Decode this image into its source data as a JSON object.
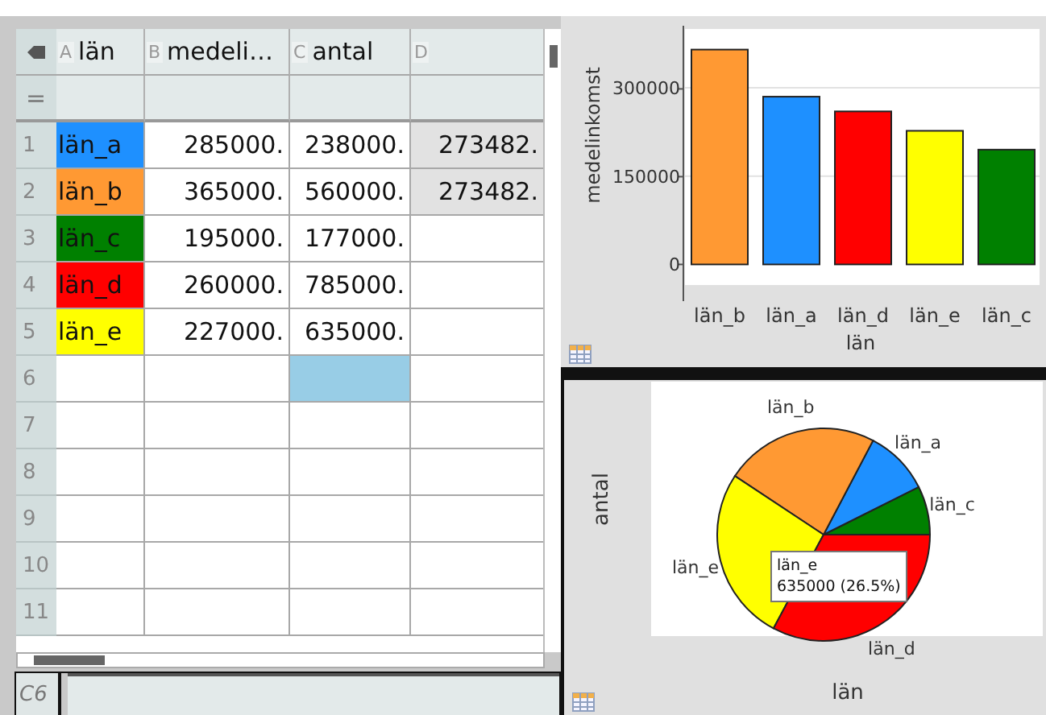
{
  "spreadsheet": {
    "columns": [
      {
        "letter": "A",
        "name": "län",
        "computed": false
      },
      {
        "letter": "B",
        "name": "medeli…",
        "computed": false
      },
      {
        "letter": "C",
        "name": "antal",
        "computed": false
      },
      {
        "letter": "D",
        "computed": true
      }
    ],
    "formula_symbol": "=",
    "rows": [
      {
        "number": "1",
        "cells": [
          {
            "text": "län_a",
            "color": "#1e90ff",
            "selected": false
          },
          {
            "text": "285000.",
            "selected": false
          },
          {
            "text": "238000.",
            "selected": false
          },
          {
            "text": "273482.",
            "selected": false
          }
        ]
      },
      {
        "number": "2",
        "cells": [
          {
            "text": "län_b",
            "color": "#ff9933",
            "selected": false
          },
          {
            "text": "365000.",
            "selected": false
          },
          {
            "text": "560000.",
            "selected": false
          },
          {
            "text": "273482.",
            "selected": false
          }
        ]
      },
      {
        "number": "3",
        "cells": [
          {
            "text": "län_c",
            "color": "#008000",
            "selected": false
          },
          {
            "text": "195000.",
            "selected": false
          },
          {
            "text": "177000.",
            "selected": false
          },
          {
            "selected": false
          }
        ]
      },
      {
        "number": "4",
        "cells": [
          {
            "text": "län_d",
            "color": "#ff0000",
            "selected": false
          },
          {
            "text": "260000.",
            "selected": false
          },
          {
            "text": "785000.",
            "selected": false
          },
          {
            "selected": false
          }
        ]
      },
      {
        "number": "5",
        "cells": [
          {
            "text": "län_e",
            "color": "#ffff00",
            "selected": false
          },
          {
            "text": "227000.",
            "selected": false
          },
          {
            "text": "635000.",
            "selected": false
          },
          {
            "selected": false
          }
        ]
      },
      {
        "number": "6",
        "cells": [
          {
            "selected": false
          },
          {
            "selected": false
          },
          {
            "selected": true
          },
          {
            "selected": false
          }
        ]
      },
      {
        "number": "7",
        "cells": [
          {
            "selected": false
          },
          {
            "selected": false
          },
          {
            "selected": false
          },
          {
            "selected": false
          }
        ]
      },
      {
        "number": "8",
        "cells": [
          {
            "selected": false
          },
          {
            "selected": false
          },
          {
            "selected": false
          },
          {
            "selected": false
          }
        ]
      },
      {
        "number": "9",
        "cells": [
          {
            "selected": false
          },
          {
            "selected": false
          },
          {
            "selected": false
          },
          {
            "selected": false
          }
        ]
      },
      {
        "number": "10",
        "cells": [
          {
            "selected": false
          },
          {
            "selected": false
          },
          {
            "selected": false
          },
          {
            "selected": false
          }
        ]
      },
      {
        "number": "11",
        "cells": [
          {
            "selected": false
          },
          {
            "selected": false
          },
          {
            "selected": false
          },
          {
            "selected": false
          }
        ]
      }
    ],
    "entry_line": {
      "cell_ref": "C6"
    }
  },
  "bar_panel": {
    "chart_data": {
      "type": "bar",
      "xlabel": "län",
      "ylabel": "medelinkomst",
      "categories": [
        "län_b",
        "län_a",
        "län_d",
        "län_e",
        "län_c"
      ],
      "values": [
        365000,
        285000,
        260000,
        227000,
        195000
      ],
      "colors": [
        "#ff9933",
        "#1e90ff",
        "#ff0000",
        "#ffff00",
        "#008000"
      ],
      "yticks": [
        0,
        150000,
        300000
      ],
      "ylim": [
        -35000,
        400000
      ]
    }
  },
  "pie_panel": {
    "chart_data": {
      "type": "pie",
      "xlabel": "län",
      "ylabel": "antal",
      "categories": [
        "län_c",
        "län_a",
        "län_b",
        "län_e",
        "län_d"
      ],
      "values": [
        7.4,
        9.9,
        23.4,
        26.5,
        32.8
      ],
      "colors": [
        "#008000",
        "#1e90ff",
        "#ff9933",
        "#ffff00",
        "#ff0000"
      ]
    },
    "tooltip": {
      "title": "län_e",
      "text": "635000 (26.5%)"
    }
  }
}
